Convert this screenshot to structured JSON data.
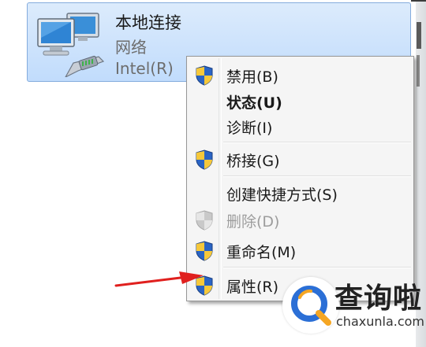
{
  "network_connection": {
    "name": "本地连接",
    "type": "网络",
    "device": "Intel(R)"
  },
  "context_menu": {
    "items": [
      {
        "label": "禁用(B)",
        "icon": "uac-shield-icon",
        "style": "normal"
      },
      {
        "label": "状态(U)",
        "icon": "",
        "style": "bold"
      },
      {
        "label": "诊断(I)",
        "icon": "",
        "style": "normal"
      },
      {
        "label": "桥接(G)",
        "icon": "uac-shield-icon",
        "style": "normal"
      },
      {
        "label": "创建快捷方式(S)",
        "icon": "",
        "style": "normal"
      },
      {
        "label": "删除(D)",
        "icon": "uac-shield-icon",
        "style": "disabled"
      },
      {
        "label": "重命名(M)",
        "icon": "uac-shield-icon",
        "style": "normal"
      },
      {
        "label": "属性(R)",
        "icon": "uac-shield-icon",
        "style": "normal"
      }
    ]
  },
  "watermark": {
    "brand": "查询啦",
    "url": "chaxunla.com"
  },
  "colors": {
    "selection_bg": "#c9e0fc",
    "selection_border": "#84acdd",
    "menu_bg": "#f5f5f5",
    "arrow": "#e0201e",
    "watermark_blue": "#2b6fd6",
    "watermark_orange": "#f5a623"
  }
}
